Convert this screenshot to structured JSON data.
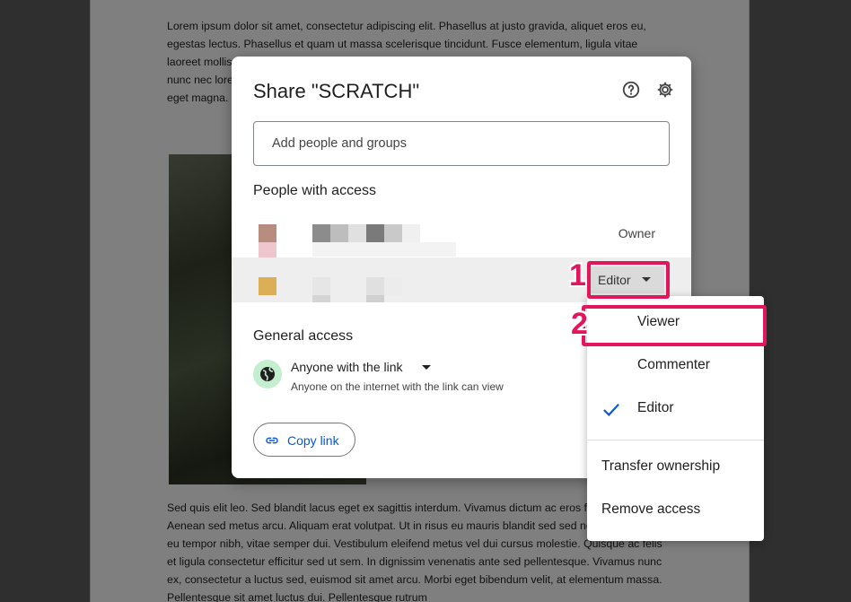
{
  "document": {
    "paragraph_top": "Lorem ipsum dolor sit amet, consectetur adipiscing elit. Phasellus at justo gravida, aliquet eros eu, egestas lectus. Phasellus et quam ut massa scelerisque tincidunt. Fusce elementum, ligula vitae laoreet mollis, mauris libero ultricies purus, sit amet imperdiet mi nulla eget massa. Integer vestibulum nunc nec lorem pulvinar, in ultrices risus laoreet. Nunc tempus, velit vitae commodo efficitur, ipsum eget magna.",
    "paragraph_bottom": "Sed quis elit leo. Sed blandit lacus eget ex sagittis interdum. Vivamus dictum ac eros fermentum. Aenean sed metus arcu. Aliquam erat volutpat. Ut in risus eu mauris blandit sed sed neque. Quisque eu tempor nibh, vitae semper dui. Vestibulum eleifend metus vel dui cursus molestie. Quisque ac felis et ligula consectetur efficitur sed ut sem. In dignissim venenatis ante sed pellentesque. Vivamus nunc ex, consectetur a luctus sed, euismod sit amet arcu. Morbi eget bibendum velit, at elementum massa. Pellentesque sit amet luctus dui. Pellentesque rutrum"
  },
  "dialog": {
    "title": "Share \"SCRATCH\"",
    "help_icon": "help-circle-icon",
    "settings_icon": "gear-icon",
    "add_placeholder": "Add people and groups",
    "people_heading": "People with access",
    "people": [
      {
        "role": "Owner",
        "avatar_color": "#b98c80"
      },
      {
        "role": "Editor",
        "avatar_color": "#dcae55"
      }
    ],
    "general_heading": "General access",
    "general_access": {
      "option": "Anyone with the link",
      "description": "Anyone on the internet with the link can view",
      "icon": "globe-icon",
      "icon_bg": "#c4eed0"
    },
    "copy_link": "Copy link",
    "link_color": "#0b57d0"
  },
  "role_menu": {
    "items": [
      "Viewer",
      "Commenter",
      "Editor"
    ],
    "selected": "Editor",
    "actions": [
      "Transfer ownership",
      "Remove access"
    ]
  },
  "annotations": {
    "step1": "1",
    "step2": "2",
    "color": "#e2175b"
  }
}
